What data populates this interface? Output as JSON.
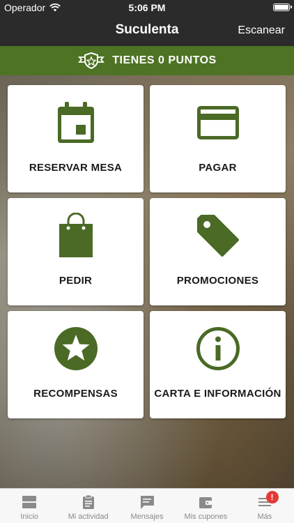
{
  "status_bar": {
    "carrier": "Operador",
    "time": "5:06 PM"
  },
  "nav": {
    "title": "Suculenta",
    "action": "Escanear"
  },
  "banner": {
    "text": "TIENES 0 PUNTOS",
    "icon": "badge-star-icon"
  },
  "colors": {
    "accent": "#4e7325",
    "icon_green": "#4a6a25",
    "badge_red": "#e53935"
  },
  "tiles": [
    {
      "label": "RESERVAR MESA",
      "icon": "calendar-icon"
    },
    {
      "label": "PAGAR",
      "icon": "credit-card-icon"
    },
    {
      "label": "PEDIR",
      "icon": "shopping-bag-icon"
    },
    {
      "label": "PROMOCIONES",
      "icon": "tag-icon"
    },
    {
      "label": "RECOMPENSAS",
      "icon": "star-circle-icon"
    },
    {
      "label": "CARTA E INFORMACIÓN",
      "icon": "info-circle-icon"
    }
  ],
  "tabs": [
    {
      "label": "Inicio",
      "icon": "home-icon"
    },
    {
      "label": "Mi actividad",
      "icon": "clipboard-icon"
    },
    {
      "label": "Mensajes",
      "icon": "chat-icon"
    },
    {
      "label": "Mis cupones",
      "icon": "wallet-icon"
    },
    {
      "label": "Más",
      "icon": "menu-icon",
      "badge": "!"
    }
  ]
}
